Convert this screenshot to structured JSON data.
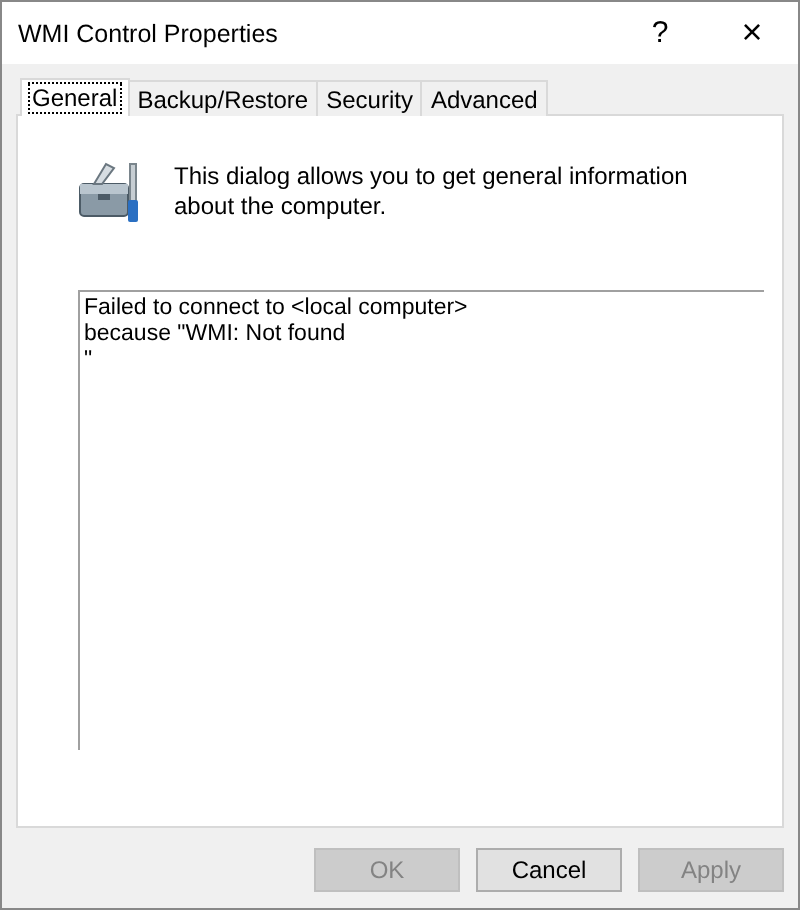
{
  "window": {
    "title": "WMI Control Properties",
    "help": "?",
    "close": "×"
  },
  "tabs": [
    {
      "label": "General",
      "selected": true
    },
    {
      "label": "Backup/Restore",
      "selected": false
    },
    {
      "label": "Security",
      "selected": false
    },
    {
      "label": "Advanced",
      "selected": false
    }
  ],
  "description": "This dialog allows you to get general information about the computer.",
  "status_text": [
    "Failed to connect to <local computer>",
    "because \"WMI: Not found",
    "\""
  ],
  "buttons": [
    {
      "label": "OK",
      "disabled": true
    },
    {
      "label": "Cancel",
      "disabled": false
    },
    {
      "label": "Apply",
      "disabled": true
    }
  ]
}
